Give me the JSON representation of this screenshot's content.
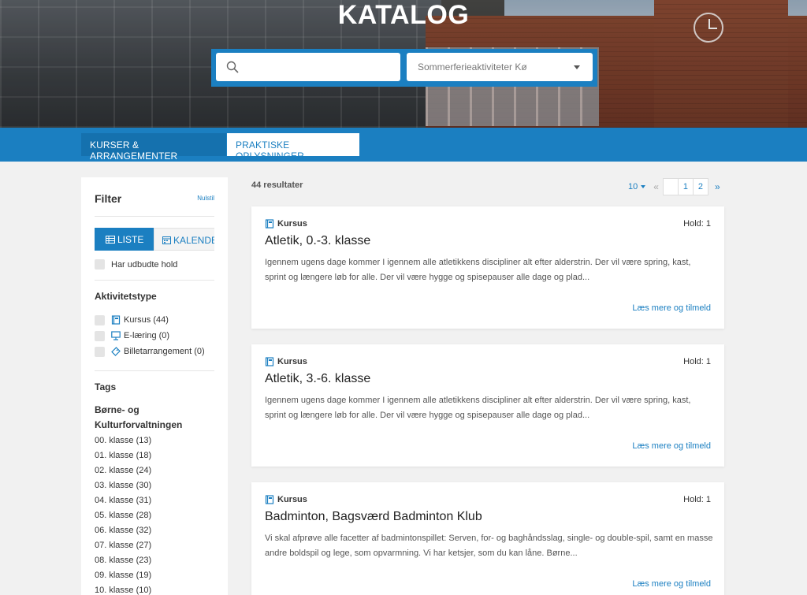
{
  "hero": {
    "title": "KATALOG",
    "search_placeholder": "",
    "select_value": "Sommerferieaktiviteter Kø"
  },
  "nav": {
    "tabs": [
      {
        "label": "KURSER & ARRANGEMENTER"
      },
      {
        "label": "PRAKTISKE OPLYSNINGER"
      }
    ]
  },
  "sidebar": {
    "title": "Filter",
    "reset": "Nulstil",
    "view_list": "LISTE",
    "view_calendar": "KALENDER",
    "has_offered": "Har udbudte hold",
    "activity_title": "Aktivitetstype",
    "activities": [
      {
        "label": "Kursus (44)",
        "icon": "book-icon"
      },
      {
        "label": "E-læring (0)",
        "icon": "monitor-icon"
      },
      {
        "label": "Billetarrangement (0)",
        "icon": "ticket-icon"
      }
    ],
    "tags_title": "Tags",
    "tags_group_line1": "Børne- og",
    "tags_group_line2": "Kulturforvaltningen",
    "tags": [
      "00. klasse (13)",
      "01. klasse (18)",
      "02. klasse (24)",
      "03. klasse (30)",
      "04. klasse (31)",
      "05. klasse (28)",
      "06. klasse (32)",
      "07. klasse (27)",
      "08. klasse (23)",
      "09. klasse (19)",
      "10. klasse (10)"
    ]
  },
  "results": {
    "count": "44 resultater",
    "per_page": "10",
    "prev": "«",
    "pages": [
      "",
      "1",
      "2"
    ],
    "next": "»"
  },
  "cards": [
    {
      "type": "Kursus",
      "hold": "Hold: 1",
      "title": "Atletik, 0.-3. klasse",
      "desc": "Igennem ugens dage kommer I igennem alle atletikkens discipliner alt efter alderstrin. Der vil være spring, kast, sprint og længere løb for alle. Der vil være hygge og spisepauser alle dage og plad...",
      "more": "Læs mere og tilmeld"
    },
    {
      "type": "Kursus",
      "hold": "Hold: 1",
      "title": "Atletik, 3.-6. klasse",
      "desc": "Igennem ugens dage kommer I igennem alle atletikkens discipliner alt efter alderstrin. Der vil være spring, kast, sprint og længere løb for alle. Der vil være hygge og spisepauser alle dage og plad...",
      "more": "Læs mere og tilmeld"
    },
    {
      "type": "Kursus",
      "hold": "Hold: 1",
      "title": "Badminton, Bagsværd Badminton Klub",
      "desc": "Vi skal afprøve alle facetter af badmintonspillet: Serven, for- og baghåndsslag, single- og double-spil, samt en masse andre boldspil og lege, som opvarmning. Vi har ketsjer, som du kan låne. Børne...",
      "more": "Læs mere og tilmeld"
    }
  ],
  "colors": {
    "brand_blue": "#1b7fc1",
    "page_bg": "#f1f1f1"
  }
}
